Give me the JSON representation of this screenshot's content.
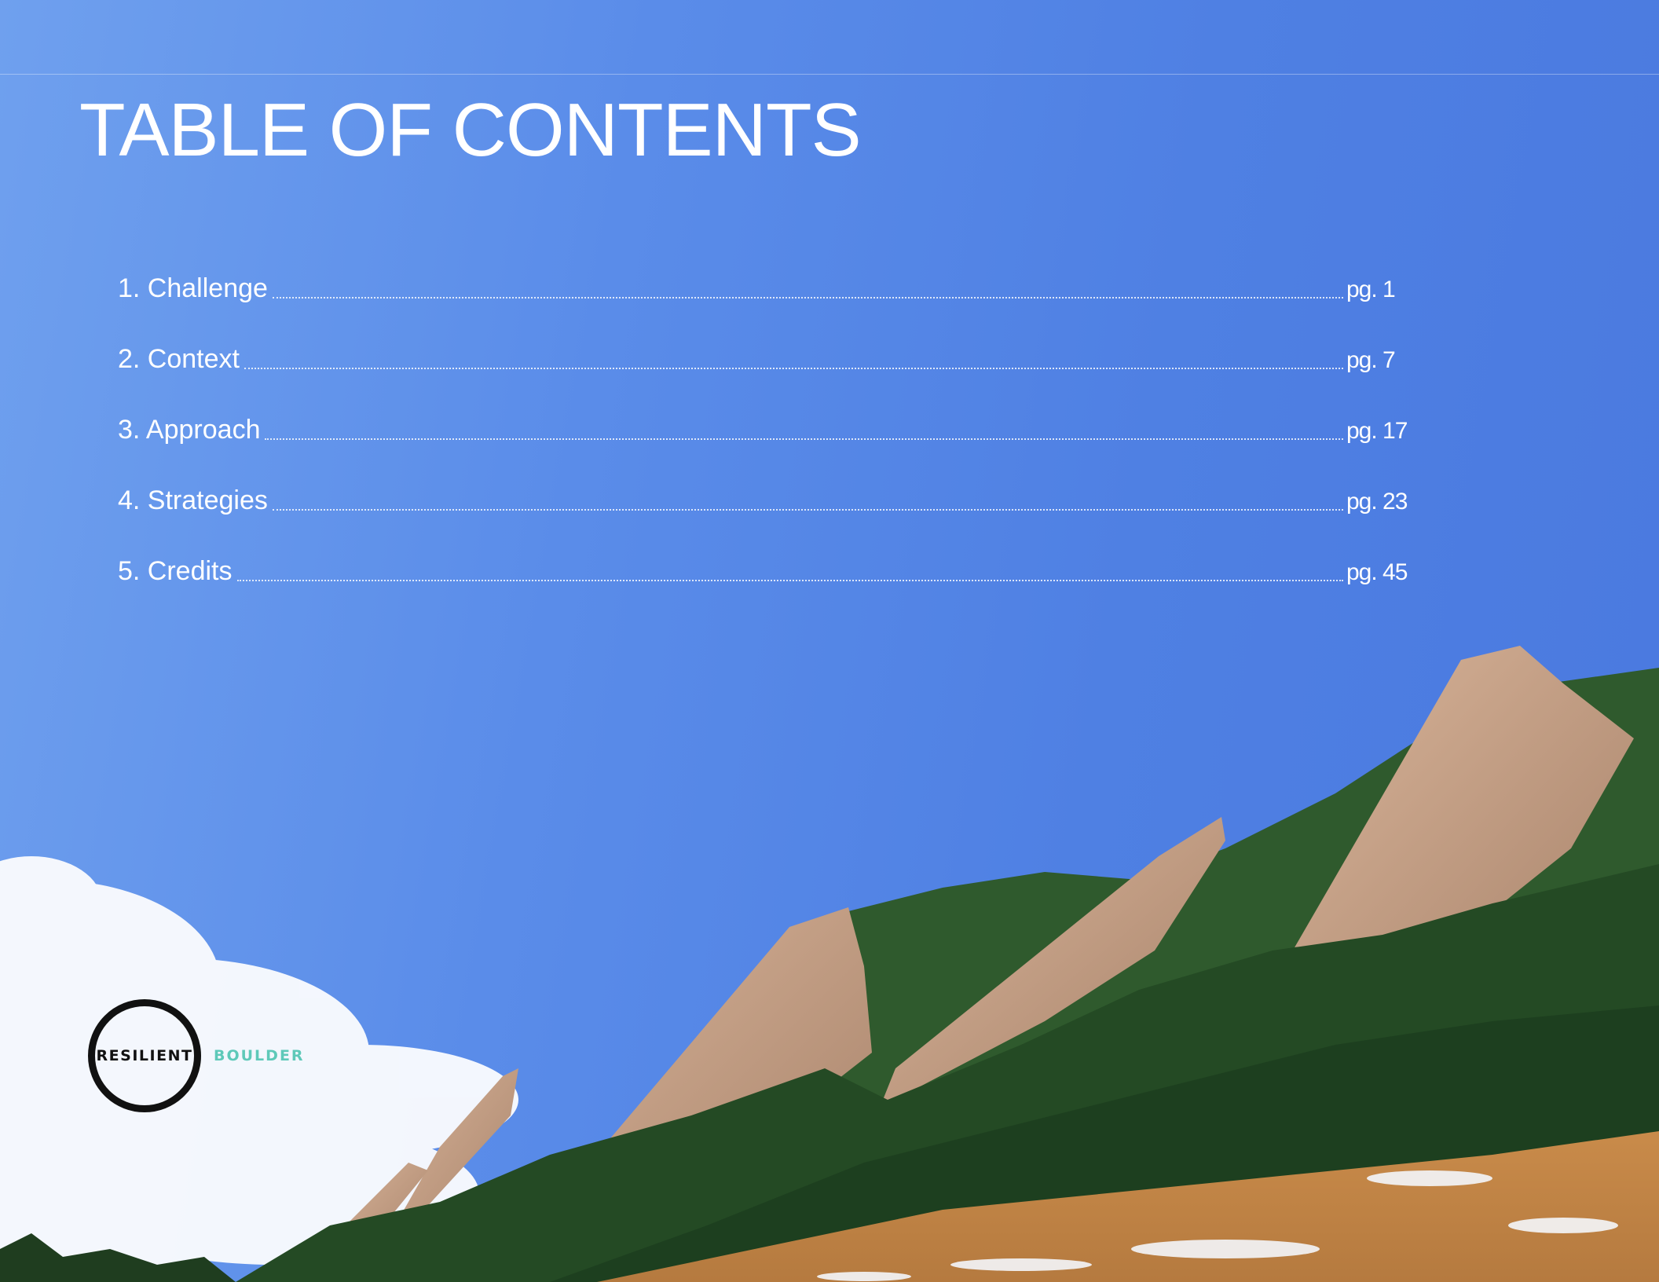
{
  "title": "TABLE OF CONTENTS",
  "toc": [
    {
      "label": "1. Challenge",
      "page": "pg. 1"
    },
    {
      "label": "2. Context",
      "page": "pg. 7"
    },
    {
      "label": "3. Approach",
      "page": "pg. 17"
    },
    {
      "label": "4. Strategies",
      "page": "pg. 23"
    },
    {
      "label": "5. Credits",
      "page": "pg. 45"
    }
  ],
  "logo": {
    "word": "RESILIENT",
    "sub": "BOULDER",
    "sub_color": "#5ec9b9"
  },
  "colors": {
    "sky": "#5a8ce9",
    "text": "#ffffff"
  }
}
